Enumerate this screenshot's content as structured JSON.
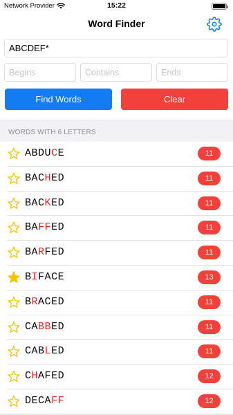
{
  "status_bar": {
    "carrier": "Network Provider",
    "time": "15:22",
    "battery_level": 1.0
  },
  "nav": {
    "title": "Word Finder",
    "settings_icon": "gear-icon"
  },
  "search": {
    "pattern_value": "ABCDEF*",
    "begins_placeholder": "Begins",
    "contains_placeholder": "Contains",
    "ends_placeholder": "Ends"
  },
  "buttons": {
    "find_label": "Find Words",
    "clear_label": "Clear"
  },
  "colors": {
    "accent_blue": "#137cf3",
    "destructive_red": "#f2403a",
    "highlight_red": "#e62020",
    "star_yellow": "#f5c400"
  },
  "results": {
    "section_title": "WORDS WITH 6 LETTERS",
    "words": [
      {
        "text": "ABDUCE",
        "highlight": [
          4
        ],
        "score": "11",
        "favorite": false
      },
      {
        "text": "BACHED",
        "highlight": [
          3
        ],
        "score": "11",
        "favorite": false
      },
      {
        "text": "BACKED",
        "highlight": [
          3
        ],
        "score": "11",
        "favorite": false
      },
      {
        "text": "BAFFED",
        "highlight": [
          2,
          3
        ],
        "score": "11",
        "favorite": false
      },
      {
        "text": "BARFED",
        "highlight": [
          2
        ],
        "score": "11",
        "favorite": false
      },
      {
        "text": "BIFACE",
        "highlight": [
          1
        ],
        "score": "13",
        "favorite": true
      },
      {
        "text": "BRACED",
        "highlight": [
          1
        ],
        "score": "11",
        "favorite": false
      },
      {
        "text": "CABBED",
        "highlight": [
          2,
          3
        ],
        "score": "11",
        "favorite": false
      },
      {
        "text": "CABLED",
        "highlight": [
          3
        ],
        "score": "11",
        "favorite": false
      },
      {
        "text": "CHAFED",
        "highlight": [
          1
        ],
        "score": "12",
        "favorite": false
      },
      {
        "text": "DECAFF",
        "highlight": [
          4,
          5
        ],
        "score": "12",
        "favorite": false
      }
    ]
  }
}
